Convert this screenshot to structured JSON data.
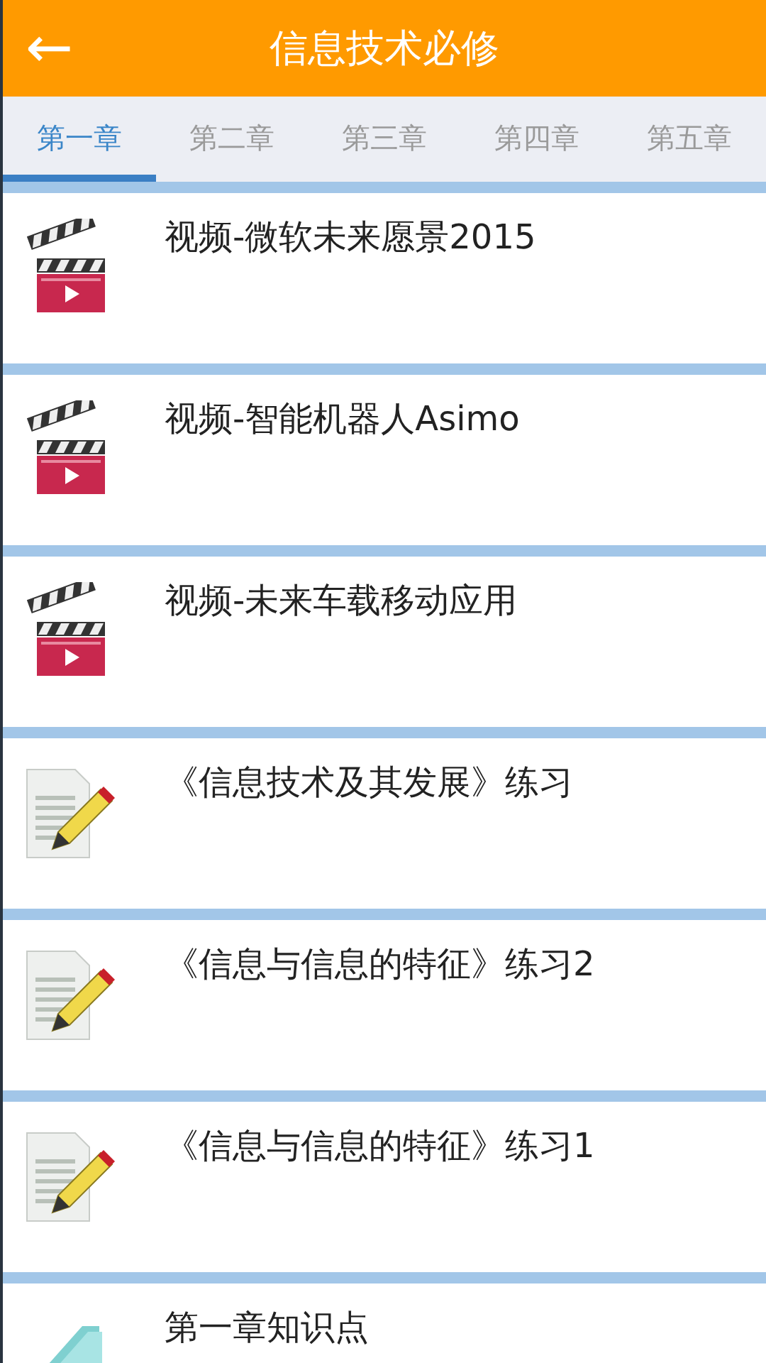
{
  "header": {
    "back_icon": "←",
    "title": "信息技术必修"
  },
  "tabs": [
    {
      "label": "第一章",
      "selected": true
    },
    {
      "label": "第二章",
      "selected": false
    },
    {
      "label": "第三章",
      "selected": false
    },
    {
      "label": "第四章",
      "selected": false
    },
    {
      "label": "第五章",
      "selected": false
    }
  ],
  "items": [
    {
      "kind": "video",
      "title": "视频-微软未来愿景2015"
    },
    {
      "kind": "video",
      "title": "视频-智能机器人Asimo"
    },
    {
      "kind": "video",
      "title": "视频-未来车载移动应用"
    },
    {
      "kind": "exercise",
      "title": "《信息技术及其发展》练习"
    },
    {
      "kind": "exercise",
      "title": "《信息与信息的特征》练习2"
    },
    {
      "kind": "exercise",
      "title": "《信息与信息的特征》练习1"
    },
    {
      "kind": "notes",
      "title": "第一章知识点"
    }
  ]
}
